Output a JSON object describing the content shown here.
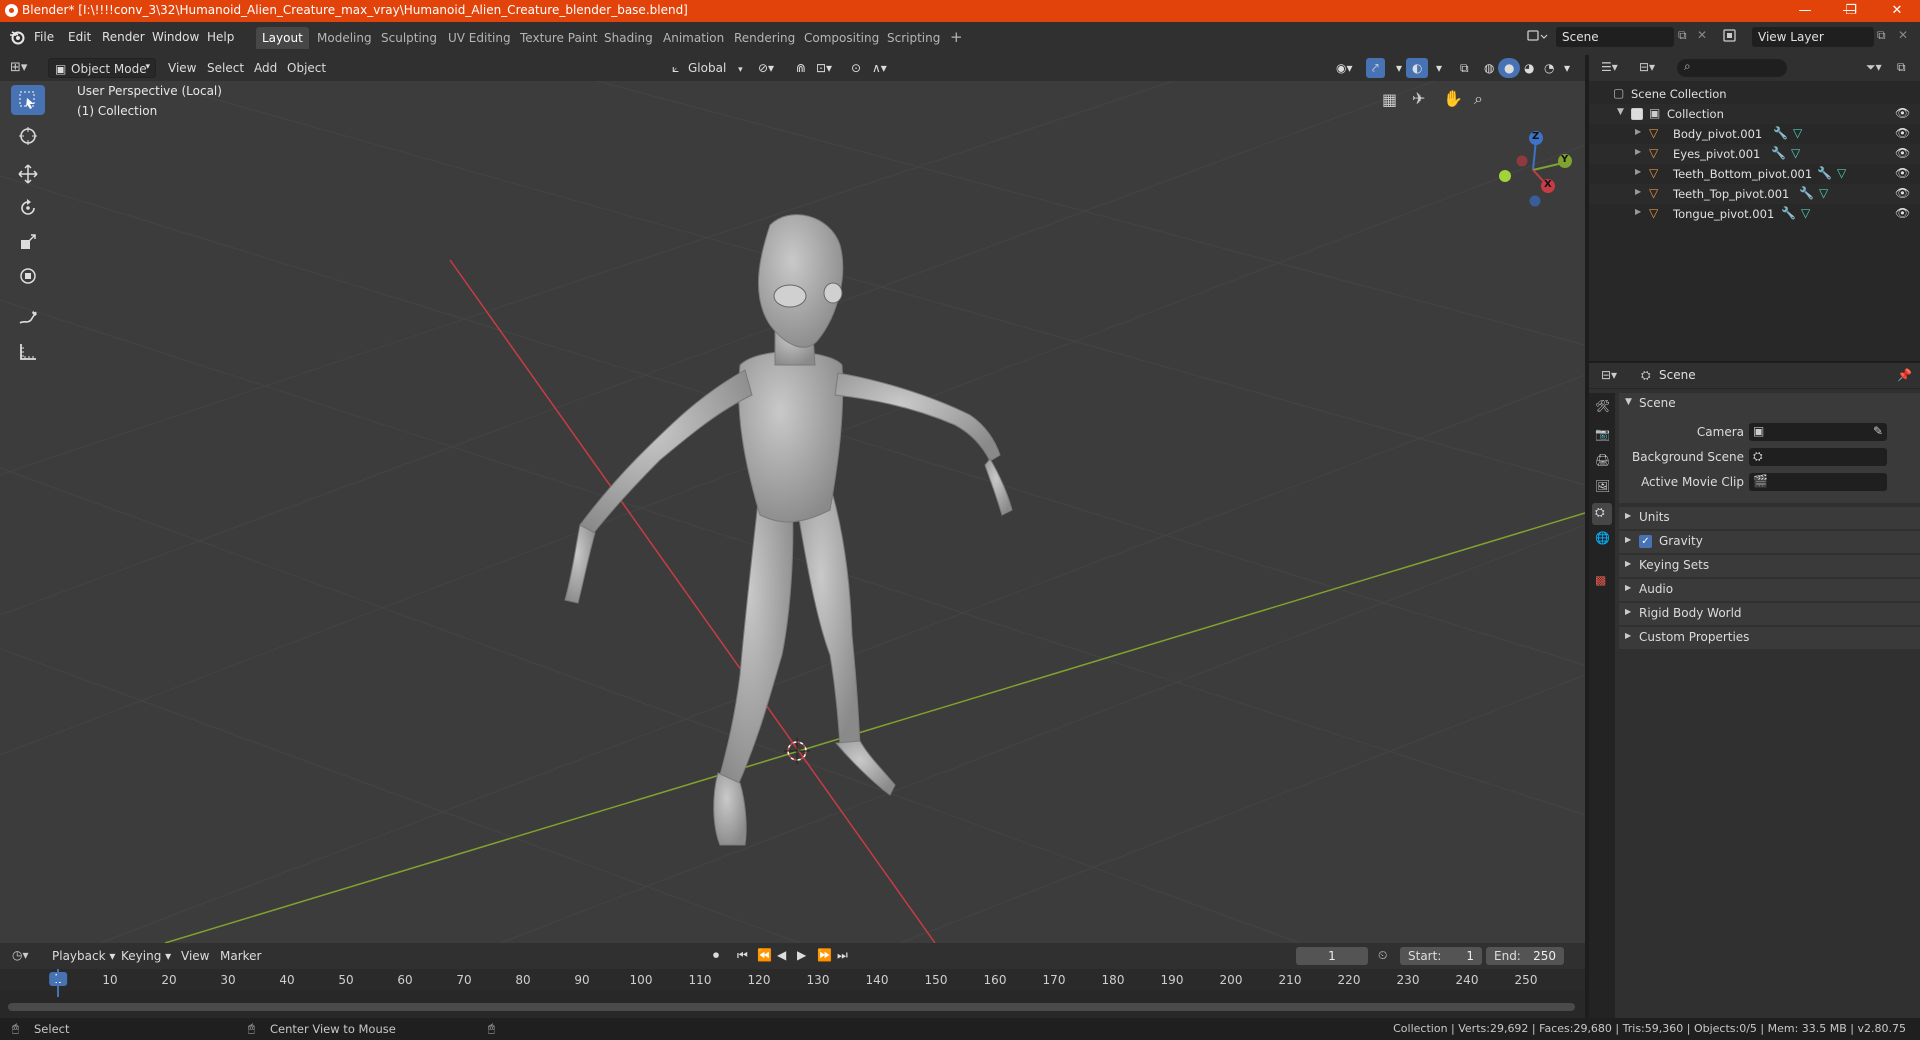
{
  "window": {
    "title": "Blender* [I:\\!!!!conv_3\\32\\Humanoid_Alien_Creature_max_vray\\Humanoid_Alien_Creature_blender_base.blend]",
    "controls": [
      "—",
      "❐",
      "✕"
    ]
  },
  "menubar": {
    "menus": [
      "File",
      "Edit",
      "Render",
      "Window",
      "Help"
    ],
    "workspaces": [
      "Layout",
      "Modeling",
      "Sculpting",
      "UV Editing",
      "Texture Paint",
      "Shading",
      "Animation",
      "Rendering",
      "Compositing",
      "Scripting"
    ],
    "active_workspace": "Layout",
    "add_tab": "+",
    "scene_name": "Scene",
    "view_layer": "View Layer"
  },
  "viewport": {
    "mode": "Object Mode",
    "menus": [
      "View",
      "Select",
      "Add",
      "Object"
    ],
    "transform_orientation": "Global",
    "overlay_line1": "User Perspective (Local)",
    "overlay_line2": "(1) Collection",
    "gizmo_axes": {
      "z": "Z",
      "y": "Y",
      "x": "X"
    },
    "colors": {
      "x_axis": "#c73c44",
      "y_axis": "#7fa32e",
      "grid": "#454545",
      "background": "#3c3c3c",
      "select_active": "#4772b3"
    }
  },
  "toolbar": {
    "tools": [
      "select-box-icon",
      "cursor-icon",
      "move-icon",
      "rotate-icon",
      "scale-icon",
      "transform-icon",
      "annotate-icon",
      "measure-icon"
    ]
  },
  "outliner": {
    "search_placeholder": "",
    "scene_collection": "Scene Collection",
    "collection": "Collection",
    "objects": [
      "Body_pivot.001",
      "Eyes_pivot.001",
      "Teeth_Bottom_pivot.001",
      "Teeth_Top_pivot.001",
      "Tongue_pivot.001"
    ]
  },
  "properties": {
    "context": "Scene",
    "panel_title": "Scene",
    "fields": {
      "camera_label": "Camera",
      "background_scene_label": "Background Scene",
      "active_movie_clip_label": "Active Movie Clip"
    },
    "subpanels": [
      "Units",
      "Gravity",
      "Keying Sets",
      "Audio",
      "Rigid Body World",
      "Custom Properties"
    ],
    "gravity_checked": true
  },
  "timeline": {
    "menus": [
      "Playback",
      "Keying",
      "View",
      "Marker"
    ],
    "current_frame": "1",
    "start_label": "Start:",
    "start_value": "1",
    "end_label": "End:",
    "end_value": "250",
    "ruler": [
      "1",
      "10",
      "20",
      "30",
      "40",
      "50",
      "60",
      "70",
      "80",
      "90",
      "100",
      "110",
      "120",
      "130",
      "140",
      "150",
      "160",
      "170",
      "180",
      "190",
      "200",
      "210",
      "220",
      "230",
      "240",
      "250"
    ]
  },
  "statusbar": {
    "left_action": "Select",
    "middle_action": "Center View to Mouse",
    "stats": "Collection | Verts:29,692 | Faces:29,680 | Tris:59,360 | Objects:0/5 | Mem: 33.5 MB | v2.80.75"
  }
}
